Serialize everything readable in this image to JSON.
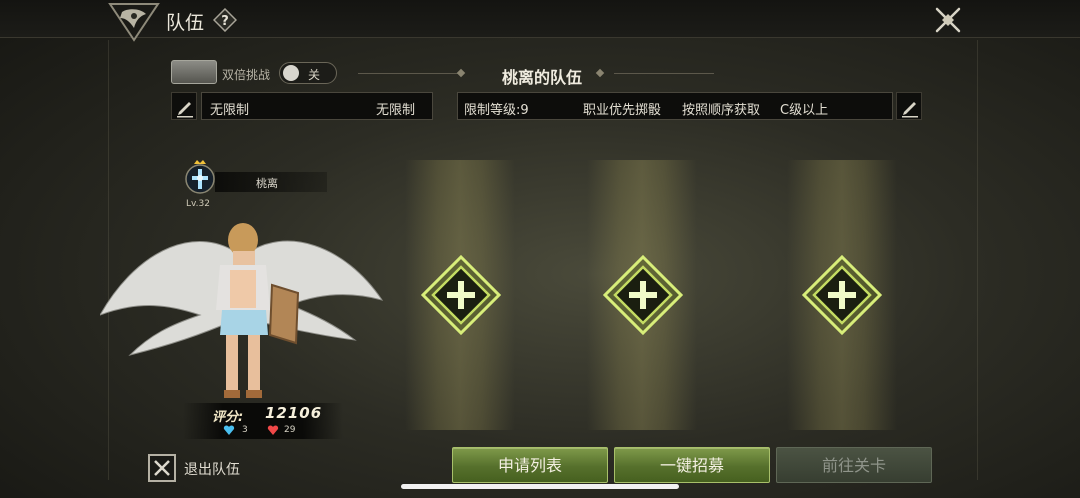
{
  "header": {
    "title": "队伍",
    "help_symbol": "?"
  },
  "double_challenge": {
    "label": "双倍挑战",
    "toggle_state": "关"
  },
  "team_title": "桃离的队伍",
  "left_field": {
    "value_left": "无限制",
    "value_right": "无限制"
  },
  "right_field": {
    "items": [
      "限制等级:9",
      "职业优先掷骰",
      "按照顺序获取",
      "C级以上"
    ]
  },
  "character": {
    "name": "桃离",
    "level": "Lv.32",
    "score_label": "评分:",
    "score": "12106",
    "blue_count": "3",
    "red_count": "29"
  },
  "bottom": {
    "exit_label": "退出队伍",
    "apply_list": "申请列表",
    "recruit": "一键招募",
    "go_stage": "前往关卡"
  },
  "colors": {
    "accent_green": "#56702c",
    "slot_glow": "#d8ee7a",
    "disabled": "#373e31"
  },
  "icons": {
    "emblem": "dragon-emblem-icon",
    "help": "question-diamond-icon",
    "close": "close-cross-icon",
    "edit": "pencil-icon",
    "add_slot": "plus-diamond-icon",
    "exit": "x-checkbox-icon",
    "class": "holy-cross-icon",
    "crown": "crown-icon"
  }
}
